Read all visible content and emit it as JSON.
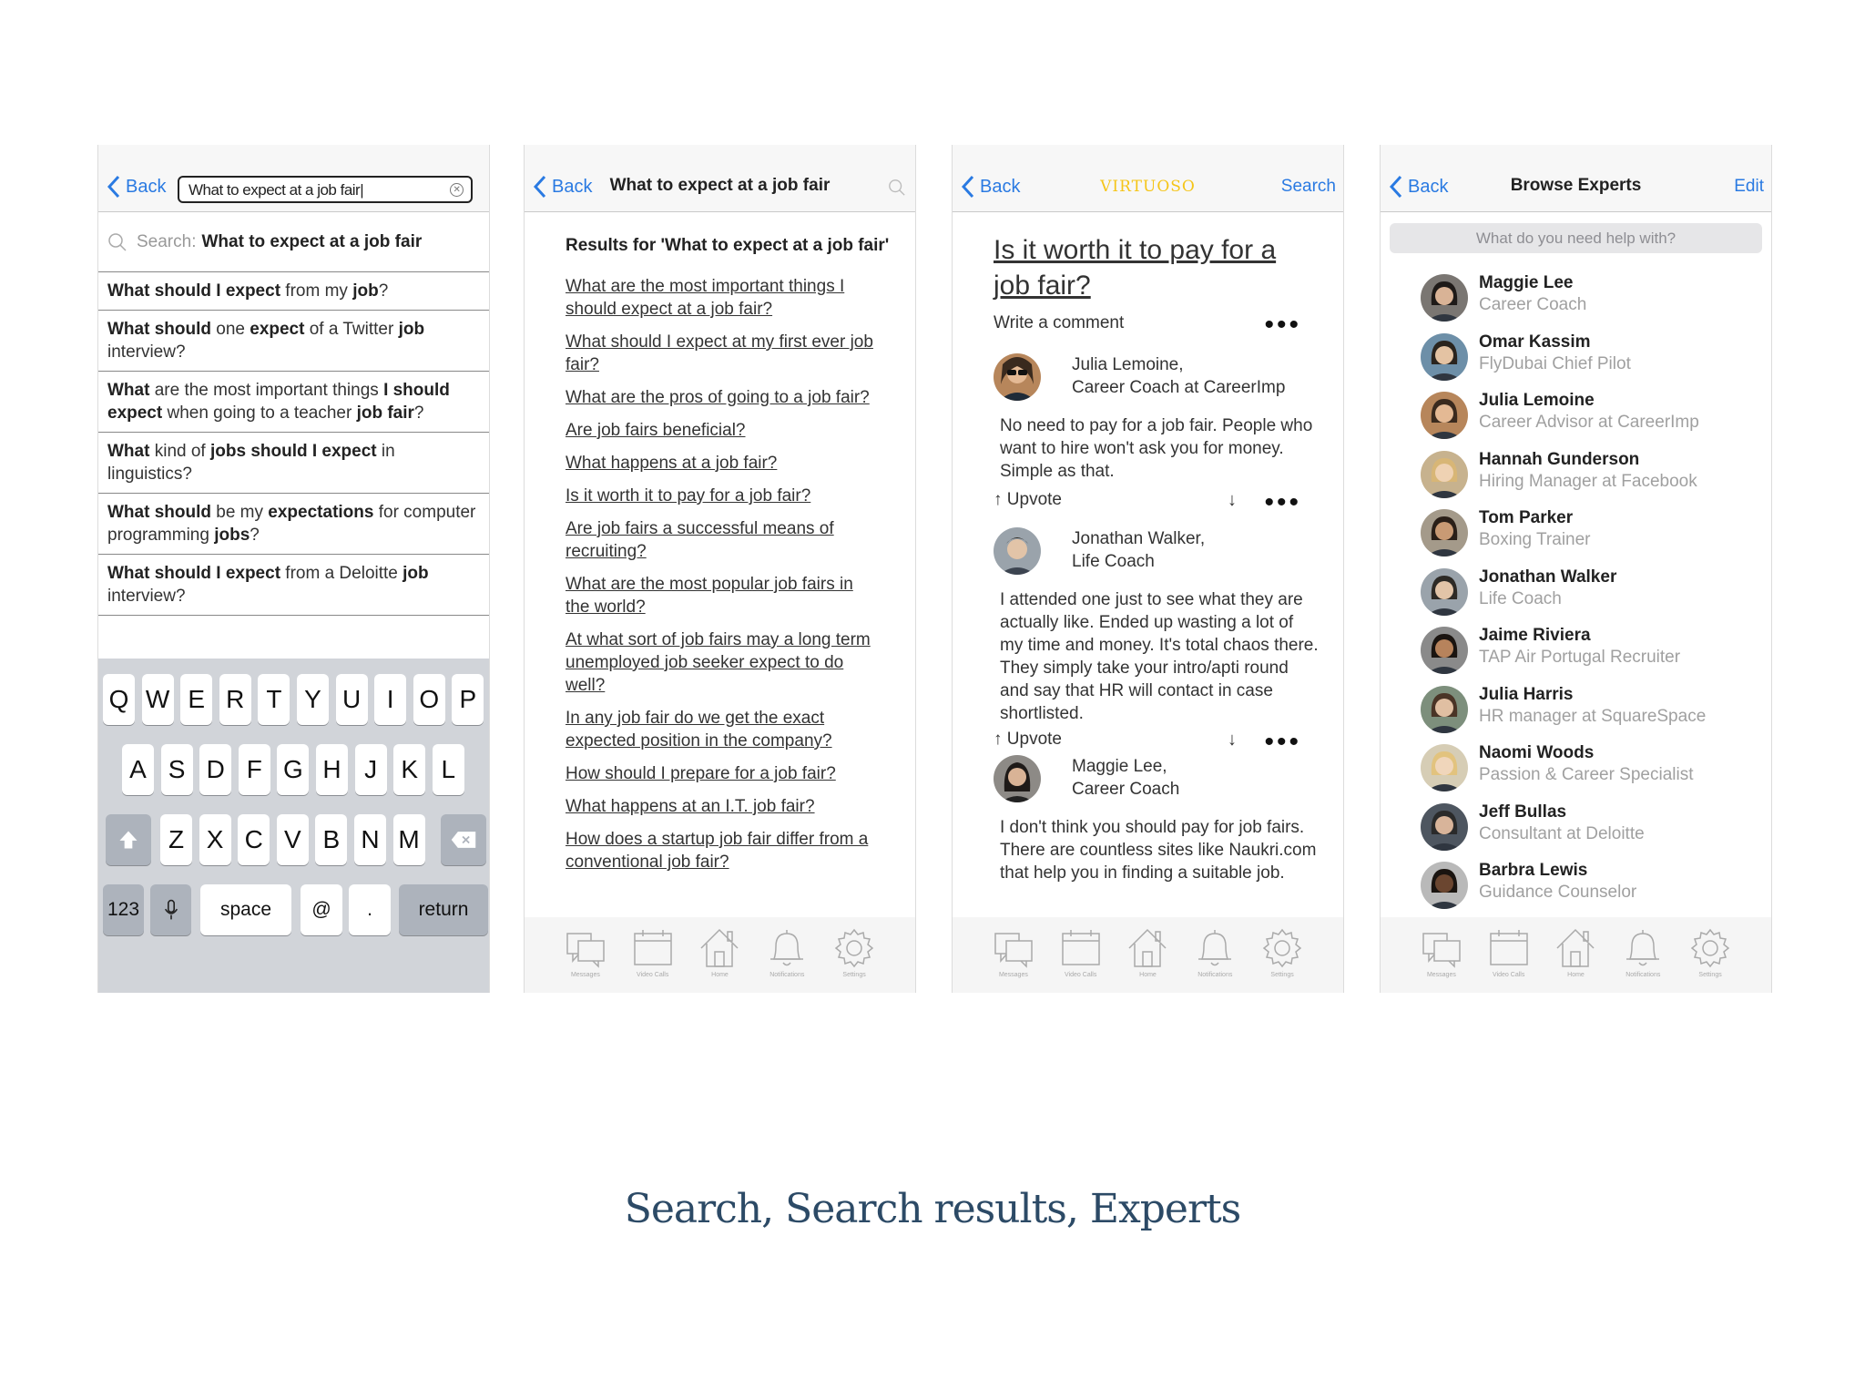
{
  "screen1": {
    "back": "Back",
    "search_value": "What to expect at a job fair",
    "search_prefix": "Search:",
    "search_query": "What to expect at a job fair",
    "suggestions": [
      [
        {
          "t": "What should I expect",
          "b": true
        },
        {
          "t": " from my ",
          "b": false
        },
        {
          "t": "job",
          "b": true
        },
        {
          "t": "?",
          "b": false
        }
      ],
      [
        {
          "t": "What should",
          "b": true
        },
        {
          "t": " one ",
          "b": false
        },
        {
          "t": "expect",
          "b": true
        },
        {
          "t": " of a Twitter ",
          "b": false
        },
        {
          "t": "job",
          "b": true
        },
        {
          "t": " interview?",
          "b": false
        }
      ],
      [
        {
          "t": "What",
          "b": true
        },
        {
          "t": " are the most important things ",
          "b": false
        },
        {
          "t": "I should expect",
          "b": true
        },
        {
          "t": " when going to a teacher ",
          "b": false
        },
        {
          "t": "job fair",
          "b": true
        },
        {
          "t": "?",
          "b": false
        }
      ],
      [
        {
          "t": "What",
          "b": true
        },
        {
          "t": " kind of ",
          "b": false
        },
        {
          "t": "jobs should I expect",
          "b": true
        },
        {
          "t": " in linguistics?",
          "b": false
        }
      ],
      [
        {
          "t": "What should",
          "b": true
        },
        {
          "t": " be my ",
          "b": false
        },
        {
          "t": "expectations",
          "b": true
        },
        {
          "t": " for computer programming ",
          "b": false
        },
        {
          "t": "jobs",
          "b": true
        },
        {
          "t": "?",
          "b": false
        }
      ],
      [
        {
          "t": "What should I expect",
          "b": true
        },
        {
          "t": " from a Deloitte ",
          "b": false
        },
        {
          "t": "job",
          "b": true
        },
        {
          "t": " interview?",
          "b": false
        }
      ]
    ],
    "keyboard": {
      "row1": [
        "Q",
        "W",
        "E",
        "R",
        "T",
        "Y",
        "U",
        "I",
        "O",
        "P"
      ],
      "row2": [
        "A",
        "S",
        "D",
        "F",
        "G",
        "H",
        "J",
        "K",
        "L"
      ],
      "row3": [
        "Z",
        "X",
        "C",
        "V",
        "B",
        "N",
        "M"
      ],
      "num": "123",
      "space": "space",
      "at": "@",
      "dot": ".",
      "return": "return"
    }
  },
  "screen2": {
    "back": "Back",
    "title": "What to expect at a job fair",
    "results_heading": "Results for 'What to expect at a job fair'",
    "results": [
      "What are the most important things I should expect at a job fair?",
      "What should I expect at my first ever job fair?",
      "What are the pros of going to a job fair?",
      "Are job fairs beneficial?",
      "What happens at a job fair?",
      "Is it worth it to pay for a job fair?",
      "Are job fairs a successful means of recruiting?",
      "What are the most popular job fairs in the world?",
      "At what sort of job fairs may a long term unemployed job seeker expect to do well?",
      "In any job fair do we get the exact expected position in the company?",
      "How should I prepare for a job fair?",
      "What happens at an I.T. job fair?",
      "How does a startup job fair differ from a conventional job fair?"
    ]
  },
  "screen3": {
    "back": "Back",
    "brand": "VIRTUOSO",
    "search": "Search",
    "question": "Is it worth it to pay for a job fair?",
    "write_comment": "Write a comment",
    "dots": "•••",
    "upvote": "↑  Upvote",
    "down": "↓",
    "comments": [
      {
        "name1": "Julia Lemoine,",
        "name2": "Career Coach at CareerImp",
        "text": "No need to pay for a job fair. People who want to hire won't ask you for money. Simple as that."
      },
      {
        "name1": "Jonathan Walker,",
        "name2": "Life Coach",
        "text": "I attended one just to see what they are actually like. Ended up wasting a lot of my time and money. It's total chaos there. They simply take your intro/apti round and say that HR will contact in case shortlisted."
      },
      {
        "name1": "Maggie Lee,",
        "name2": "Career Coach",
        "text": "I don't think you should pay for job fairs. There are countless sites like Naukri.com that help you in finding a suitable job."
      }
    ]
  },
  "screen4": {
    "back": "Back",
    "title": "Browse Experts",
    "edit": "Edit",
    "help_placeholder": "What do you need help with?",
    "experts": [
      {
        "name": "Maggie Lee",
        "role": "Career Coach"
      },
      {
        "name": "Omar Kassim",
        "role": "FlyDubai Chief Pilot"
      },
      {
        "name": "Julia Lemoine",
        "role": "Career Advisor at CareerImp"
      },
      {
        "name": "Hannah Gunderson",
        "role": "Hiring Manager at Facebook"
      },
      {
        "name": "Tom Parker",
        "role": "Boxing Trainer"
      },
      {
        "name": "Jonathan Walker",
        "role": "Life Coach"
      },
      {
        "name": "Jaime Riviera",
        "role": "TAP Air Portugal Recruiter"
      },
      {
        "name": "Julia Harris",
        "role": "HR manager at SquareSpace"
      },
      {
        "name": "Naomi Woods",
        "role": "Passion & Career Specialist"
      },
      {
        "name": "Jeff Bullas",
        "role": "Consultant at Deloitte"
      },
      {
        "name": "Barbra Lewis",
        "role": "Guidance Counselor"
      }
    ]
  },
  "tabs": [
    "Messages",
    "Video Calls",
    "Home",
    "Notifications",
    "Settings"
  ],
  "caption": "Search, Search results, Experts",
  "colors": {
    "link_blue": "#2a7ae2",
    "brand_yellow": "#f5c518",
    "caption_blue": "#2c4a66",
    "keyboard_bg": "#d1d4d9"
  }
}
